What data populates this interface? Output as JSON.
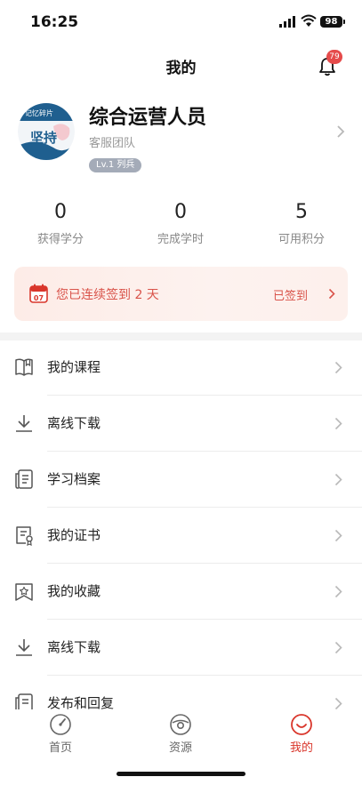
{
  "status_bar": {
    "time": "16:25",
    "battery": "98"
  },
  "header": {
    "title": "我的",
    "notification_count": "79"
  },
  "profile": {
    "avatar_text_top": "记忆碎片",
    "avatar_text_main": "坚持",
    "name": "综合运营人员",
    "team": "客服团队",
    "level": "Lv.1 列兵"
  },
  "stats": [
    {
      "value": "0",
      "label": "获得学分"
    },
    {
      "value": "0",
      "label": "完成学时"
    },
    {
      "value": "5",
      "label": "可用积分"
    }
  ],
  "signin": {
    "calendar_day": "07",
    "text": "您已连续签到 2 天",
    "status": "已签到"
  },
  "menu": [
    {
      "label": "我的课程",
      "icon": "book-icon"
    },
    {
      "label": "离线下载",
      "icon": "download-icon"
    },
    {
      "label": "学习档案",
      "icon": "archive-icon"
    },
    {
      "label": "我的证书",
      "icon": "certificate-icon"
    },
    {
      "label": "我的收藏",
      "icon": "star-icon"
    },
    {
      "label": "离线下载",
      "icon": "download-icon"
    },
    {
      "label": "发布和回复",
      "icon": "post-icon"
    }
  ],
  "tabs": [
    {
      "label": "首页",
      "icon": "home-icon"
    },
    {
      "label": "资源",
      "icon": "resource-icon"
    },
    {
      "label": "我的",
      "icon": "profile-icon"
    }
  ],
  "colors": {
    "accent": "#d9362b",
    "badge": "#e54b4b",
    "banner_bg": "#fdece7"
  }
}
